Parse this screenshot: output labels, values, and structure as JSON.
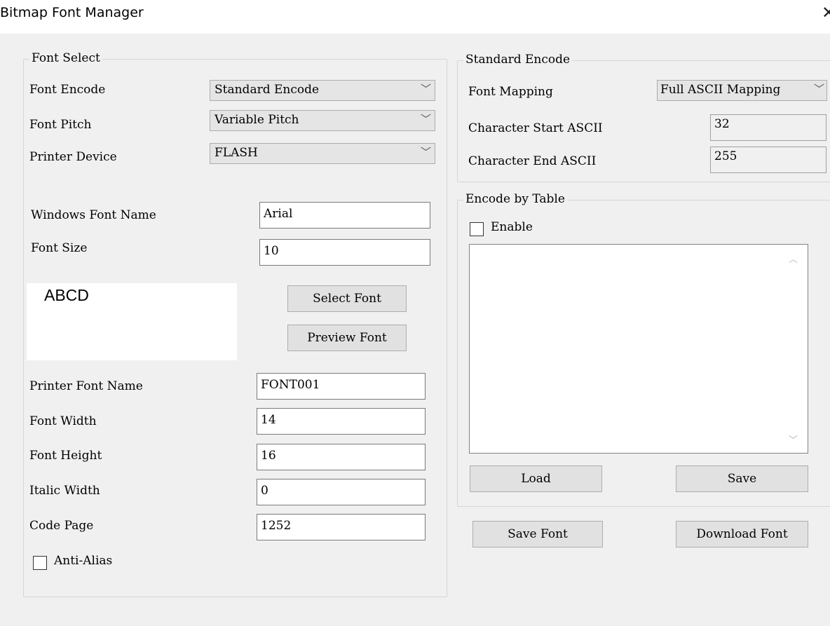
{
  "window": {
    "title": "Bitmap Font Manager",
    "close_glyph": "✕"
  },
  "font_select": {
    "legend": "Font Select",
    "font_encode": {
      "label": "Font Encode",
      "value": "Standard Encode"
    },
    "font_pitch": {
      "label": "Font Pitch",
      "value": "Variable Pitch"
    },
    "printer_device": {
      "label": "Printer Device",
      "value": "FLASH"
    },
    "windows_font_name": {
      "label": "Windows Font Name",
      "value": "Arial"
    },
    "font_size": {
      "label": "Font Size",
      "value": "10"
    },
    "preview_text": "ABCD",
    "select_font_button": "Select Font",
    "preview_font_button": "Preview Font",
    "printer_font_name": {
      "label": "Printer Font Name",
      "value": "FONT001"
    },
    "font_width": {
      "label": "Font Width",
      "value": "14"
    },
    "font_height": {
      "label": "Font Height",
      "value": "16"
    },
    "italic_width": {
      "label": "Italic Width",
      "value": "0"
    },
    "code_page": {
      "label": "Code Page",
      "value": "1252"
    },
    "anti_alias": {
      "label": "Anti-Alias",
      "checked": false
    }
  },
  "standard_encode": {
    "legend": "Standard Encode",
    "font_mapping": {
      "label": "Font Mapping",
      "value": "Full ASCII Mapping"
    },
    "char_start": {
      "label": "Character Start ASCII",
      "value": "32"
    },
    "char_end": {
      "label": "Character End ASCII",
      "value": "255"
    }
  },
  "encode_by_table": {
    "legend": "Encode by Table",
    "enable": {
      "label": "Enable",
      "checked": false
    },
    "load_button": "Load",
    "save_button": "Save"
  },
  "footer": {
    "save_font_button": "Save Font",
    "download_font_button": "Download Font"
  },
  "icons": {
    "dropdown": "chevron-down-icon",
    "close": "close-icon",
    "scroll_up": "scroll-up-icon",
    "scroll_down": "scroll-down-icon"
  }
}
